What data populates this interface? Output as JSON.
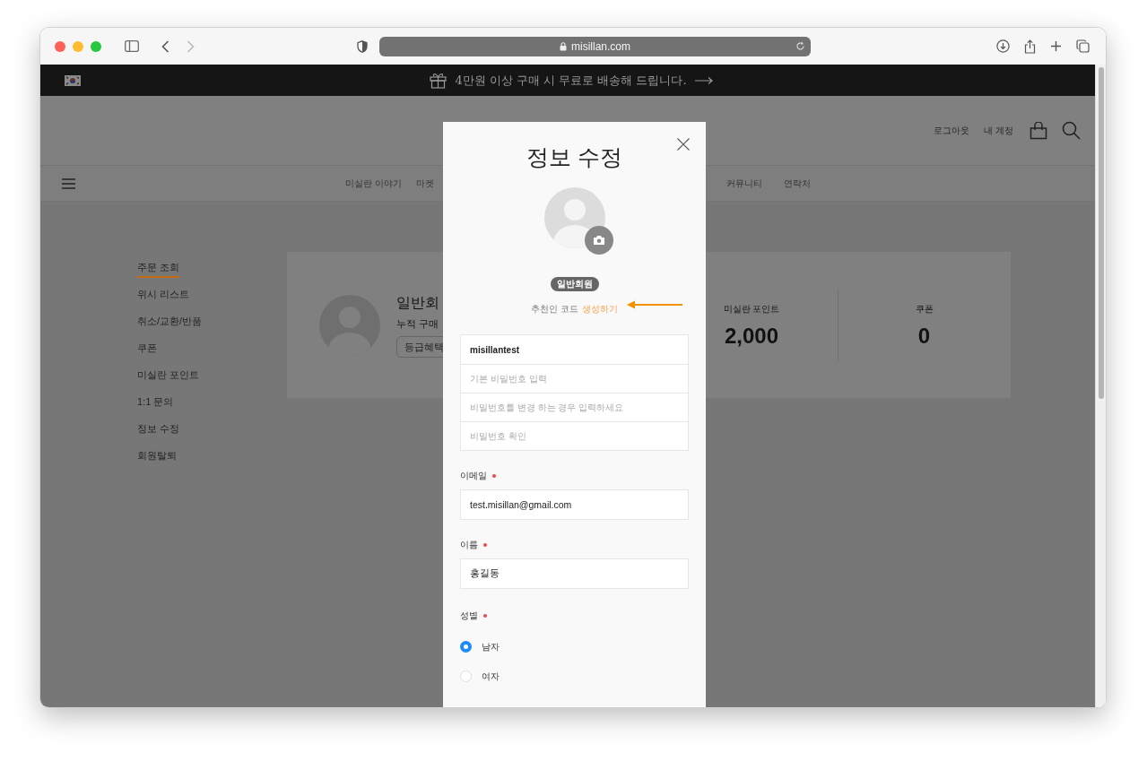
{
  "browser": {
    "url": "misillan.com"
  },
  "banner": {
    "text": "4만원 이상 구매 시 무료로 배송해 드립니다."
  },
  "header": {
    "links": [
      "로그아웃",
      "내 계정"
    ]
  },
  "nav": {
    "items": [
      "미실란 이야기",
      "마켓",
      "커뮤니티",
      "연락처"
    ]
  },
  "sidebar": {
    "items": [
      {
        "label": "주문 조회",
        "selected": true
      },
      {
        "label": "위시 리스트",
        "selected": false
      },
      {
        "label": "취소/교환/반품",
        "selected": false
      },
      {
        "label": "쿠폰",
        "selected": false
      },
      {
        "label": "미실란 포인트",
        "selected": false
      },
      {
        "label": "1:1 문의",
        "selected": false
      },
      {
        "label": "정보 수정",
        "selected": false
      },
      {
        "label": "회원탈퇴",
        "selected": false
      }
    ]
  },
  "profile_card": {
    "name": "일반회",
    "subtitle": "누적 구매",
    "button": "등급혜택",
    "stats": [
      {
        "label": "미실란 포인트",
        "value": "2,000"
      },
      {
        "label": "쿠폰",
        "value": "0"
      }
    ]
  },
  "modal": {
    "title": "정보 수정",
    "badge": "일반회원",
    "referral": {
      "label": "추천인 코드",
      "link": "생성하기"
    },
    "account_fields": [
      {
        "value": "misillantest"
      },
      {
        "placeholder": "기본 비밀번호 입력"
      },
      {
        "placeholder": "비밀번호를 변경 하는 경우 입력하세요"
      },
      {
        "placeholder": "비밀번호 확인"
      }
    ],
    "fields": [
      {
        "label": "이메일",
        "required": true,
        "value": "test.misillan@gmail.com"
      },
      {
        "label": "이름",
        "required": true,
        "value": "홍길동"
      }
    ],
    "gender": {
      "label": "성별",
      "required": true,
      "options": [
        {
          "label": "남자",
          "selected": true
        },
        {
          "label": "여자",
          "selected": false
        }
      ]
    }
  }
}
